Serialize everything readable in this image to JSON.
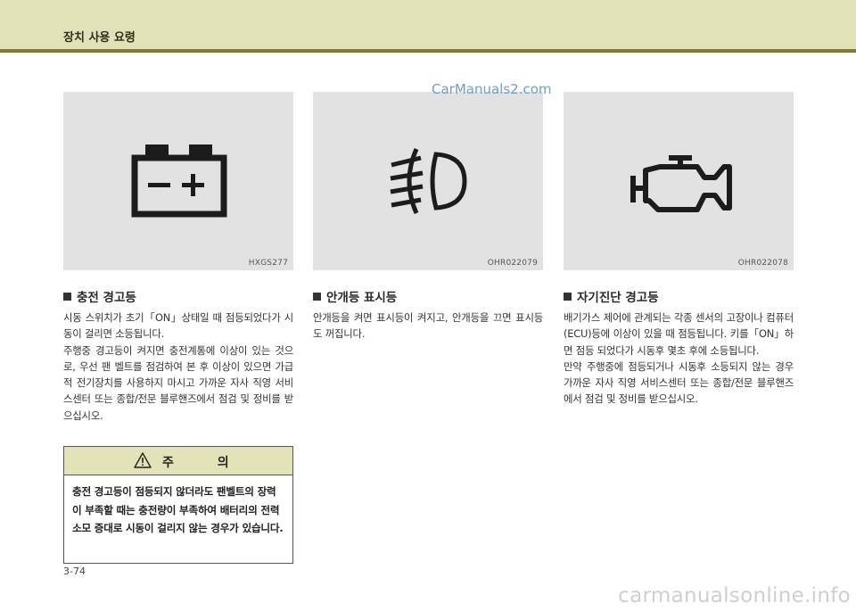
{
  "header": {
    "title": "장치 사용 요령"
  },
  "watermarks": {
    "top": "CarManuals2.com",
    "bottom": "carmanualsonline.info"
  },
  "panels": [
    {
      "code": "HXGS277",
      "icon": "battery-icon"
    },
    {
      "code": "OHR022079",
      "icon": "fog-light-icon"
    },
    {
      "code": "OHR022078",
      "icon": "engine-check-icon"
    }
  ],
  "sections": {
    "charging": {
      "title": "충전 경고등",
      "paragraphs": [
        "시동 스위치가 초기「ON」상태일 때 점등되었다가 시동이 걸리면 소등됩니다.",
        "주행중 경고등이 켜지면 충전계통에 이상이 있는 것으로, 우선 팬 벨트를 점검하여 본 후 이상이 있으면 가급적 전기장치를 사용하지 마시고 가까운 자사 직영 서비스센터 또는 종합/전문 블루핸즈에서 점검 및 정비를 받으십시오."
      ]
    },
    "fog": {
      "title": "안개등 표시등",
      "paragraphs": [
        "안개등을 켜면 표시등이 켜지고, 안개등을 끄면 표시등도 꺼집니다."
      ]
    },
    "diagnosis": {
      "title": "자기진단 경고등",
      "paragraphs": [
        "배기가스 제어에 관계되는 각종 센서의 고장이나 컴퓨터(ECU)등에 이상이 있을 때 점등됩니다. 키를「ON」하면 점등 되었다가 시동후 몇초 후에 소등됩니다.",
        "만약 주행중에 점등되거나 시동후 소등되지 않는 경우 가까운 자사 직영 서비스센터 또는 종합/전문 블루핸즈에서 점검 및 정비를 받으십시오."
      ]
    }
  },
  "caution": {
    "label": "주 의",
    "text": "충전 경고등이 점등되지 않더라도 팬벨트의 장력이 부족할 때는 충전량이 부족하여 배터리의 전력 소모 증대로 시동이 걸리지 않는 경우가 있습니다."
  },
  "footer": {
    "page": "3-74"
  }
}
